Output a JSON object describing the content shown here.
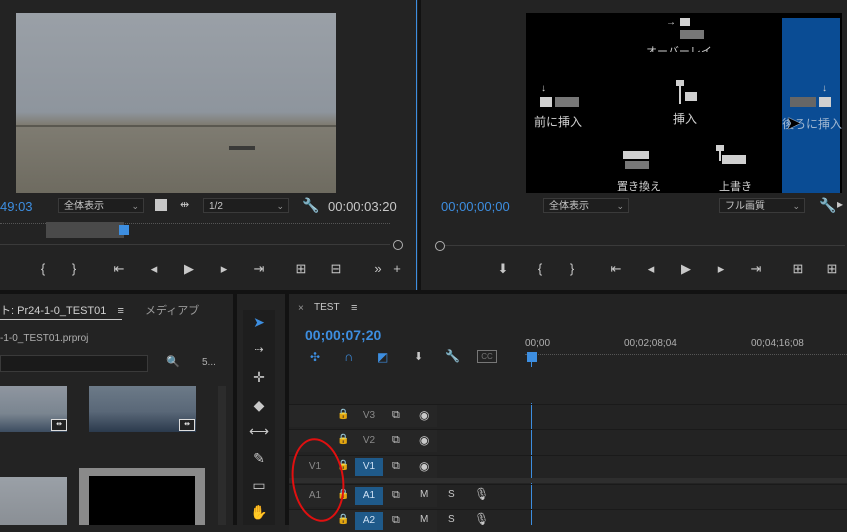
{
  "source_monitor": {
    "timecode_in": "49:03",
    "fit_label": "全体表示",
    "resolution_label": "1/2",
    "duration": "00:00:03:20"
  },
  "program_monitor": {
    "timecode": "00;00;00;00",
    "fit_label": "全体表示",
    "quality_label": "フル画質",
    "overlay": {
      "overwrite_top": "オーバーレイ",
      "insert_before": "前に挿入",
      "insert": "挿入",
      "insert_after": "後ろに挿入",
      "replace": "置き換え",
      "overwrite": "上書き"
    }
  },
  "project_panel": {
    "tab_project": "ト: Pr24-1-0_TEST01",
    "tab_menu": "≡",
    "tab_media": "メディアブ",
    "filename": "-1-0_TEST01.prproj",
    "count": "5..."
  },
  "timeline": {
    "sequence_name": "TEST",
    "menu": "≡",
    "timecode": "00;00;07;20",
    "ruler": [
      "00;00",
      "00;02;08;04",
      "00;04;16;08"
    ],
    "tracks": [
      {
        "src": "",
        "name": "V3",
        "type": "video"
      },
      {
        "src": "",
        "name": "V2",
        "type": "video"
      },
      {
        "src": "V1",
        "name": "V1",
        "type": "video"
      },
      {
        "src": "A1",
        "name": "A1",
        "type": "audio"
      },
      {
        "src": "",
        "name": "A2",
        "type": "audio"
      }
    ],
    "mute": "M",
    "solo": "S",
    "cc_label": "CC"
  },
  "colors": {
    "accent": "#3d8ee0",
    "track_active": "#1f5a8a",
    "annotation": "#e01010"
  }
}
